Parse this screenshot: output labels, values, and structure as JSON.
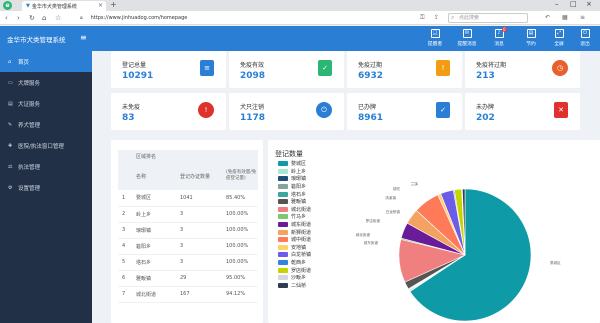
{
  "browser": {
    "tab_title": "金华市犬类管理系统",
    "url": "https://www.jinhuadog.com/homepage",
    "search_placeholder": "点此搜索",
    "logo_letter": "e"
  },
  "header": {
    "app_title": "金华市犬类管理系统",
    "menu_icon": "hamburger-icon",
    "items": [
      {
        "label": "提醒者",
        "icon": "user-icon",
        "badge": ""
      },
      {
        "label": "提醒消息",
        "icon": "message-icon",
        "badge": ""
      },
      {
        "label": "消息",
        "icon": "bell-icon",
        "badge": "0"
      },
      {
        "label": "节约",
        "icon": "calendar-icon",
        "badge": ""
      },
      {
        "label": "全屏",
        "icon": "fullscreen-icon",
        "badge": ""
      },
      {
        "label": "退出",
        "icon": "logout-icon",
        "badge": ""
      }
    ]
  },
  "sidebar": {
    "items": [
      {
        "label": "首页",
        "icon": "home-icon",
        "active": true
      },
      {
        "label": "犬牌服务",
        "icon": "dog-tag-icon",
        "active": false
      },
      {
        "label": "犬证服务",
        "icon": "certificate-icon",
        "active": false
      },
      {
        "label": "养犬管理",
        "icon": "manage-icon",
        "active": false
      },
      {
        "label": "医院/执法窗口管理",
        "icon": "hospital-icon",
        "active": false
      },
      {
        "label": "执法管理",
        "icon": "law-icon",
        "active": false
      },
      {
        "label": "设置管理",
        "icon": "settings-icon",
        "active": false
      }
    ]
  },
  "stats": [
    {
      "label": "登记总量",
      "value": "10291",
      "color": "#2a7fd4",
      "icon": "document-icon"
    },
    {
      "label": "免疫有效",
      "value": "2098",
      "color": "#2bb673",
      "icon": "check-document-icon"
    },
    {
      "label": "免疫过期",
      "value": "6932",
      "color": "#f39c12",
      "icon": "expired-document-icon"
    },
    {
      "label": "免疫将过期",
      "value": "213",
      "color": "#e8602c",
      "icon": "clock-icon"
    },
    {
      "label": "未免疫",
      "value": "83",
      "color": "#e0312d",
      "icon": "alert-icon"
    },
    {
      "label": "犬只注销",
      "value": "1178",
      "color": "#2a7fd4",
      "icon": "power-icon"
    },
    {
      "label": "已办牌",
      "value": "8961",
      "color": "#2a7fd4",
      "icon": "done-document-icon"
    },
    {
      "label": "未办牌",
      "value": "202",
      "color": "#e0312d",
      "icon": "cancel-document-icon"
    }
  ],
  "table": {
    "group_header": "区域排名",
    "columns": [
      "",
      "名称",
      "登记办证数量",
      "(免疫有效量/免疫登记量)"
    ],
    "rows": [
      [
        "1",
        "婺城区",
        "1041",
        "85.40%"
      ],
      [
        "2",
        "岭上乡",
        "3",
        "100.00%"
      ],
      [
        "3",
        "琅琊镇",
        "3",
        "100.00%"
      ],
      [
        "4",
        "箬阳乡",
        "3",
        "100.00%"
      ],
      [
        "5",
        "塔石乡",
        "3",
        "100.00%"
      ],
      [
        "6",
        "雅畈镇",
        "29",
        "95.00%"
      ],
      [
        "7",
        "城北街道",
        "167",
        "94.12%"
      ]
    ]
  },
  "chart_title": "登记数量",
  "chart_data": {
    "type": "pie",
    "title": "登记数量",
    "legend_position": "left",
    "categories": [
      "婺城区",
      "岭上乡",
      "琅琊镇",
      "箬阳乡",
      "塔石乡",
      "雅畈镇",
      "城北街道",
      "竹马乡",
      "城东街道",
      "新狮街道",
      "城中街道",
      "安地镇",
      "白龙桥镇",
      "乾西乡",
      "罗店街道",
      "沙畈乡",
      "二仙桥"
    ],
    "values": [
      1041,
      3,
      3,
      3,
      3,
      29,
      167,
      5,
      62,
      60,
      102,
      12,
      50,
      4,
      28,
      3,
      10
    ],
    "colors": [
      "#0e9aa7",
      "#a8e6cf",
      "#1f4e79",
      "#84a59d",
      "#3aa7a3",
      "#555555",
      "#f08080",
      "#7bc96f",
      "#6a1b9a",
      "#f4a261",
      "#ff7a59",
      "#ffd166",
      "#6c5ce7",
      "#2e86de",
      "#c8d400",
      "#d1d8e0",
      "#2c3e50"
    ],
    "callouts": [
      "婺城区",
      "城北街道",
      "城东街道",
      "罗店街道",
      "白龙桥镇",
      "兰溪",
      "胡宅",
      "汤溪镇"
    ]
  }
}
